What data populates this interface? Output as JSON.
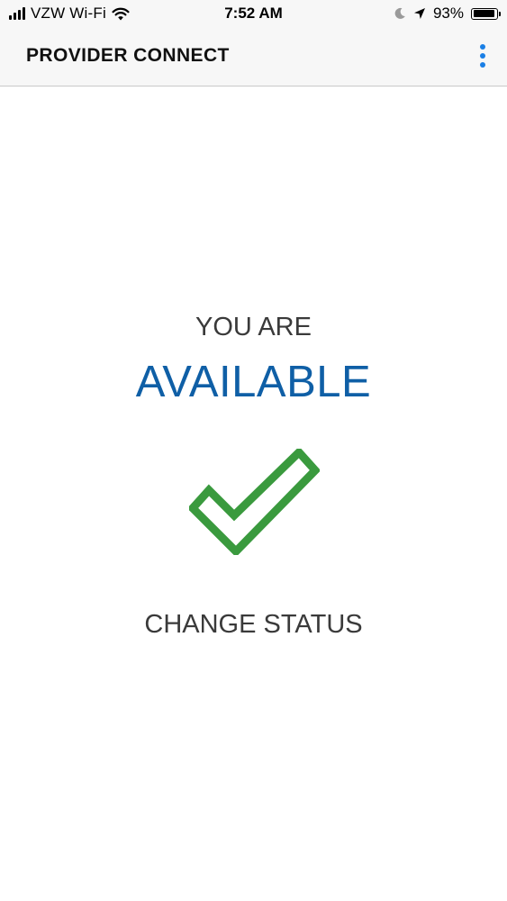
{
  "status_bar": {
    "carrier": "VZW Wi-Fi",
    "time": "7:52 AM",
    "battery": "93%",
    "battery_level": 0.93,
    "icons": [
      "signal-icon",
      "wifi-icon",
      "moon-icon",
      "location-arrow-icon",
      "battery-icon"
    ]
  },
  "header": {
    "title": "PROVIDER CONNECT",
    "menu_icon": "vertical-dots-icon"
  },
  "main": {
    "status_prefix": "YOU ARE",
    "status_value": "AVAILABLE",
    "status_icon": "checkmark-icon",
    "change_status_label": "CHANGE STATUS"
  },
  "colors": {
    "status_blue": "#0f5fa6",
    "check_green": "#3a9a3e",
    "menu_blue": "#1a7fe5",
    "text_gray": "#3a3a3a"
  }
}
